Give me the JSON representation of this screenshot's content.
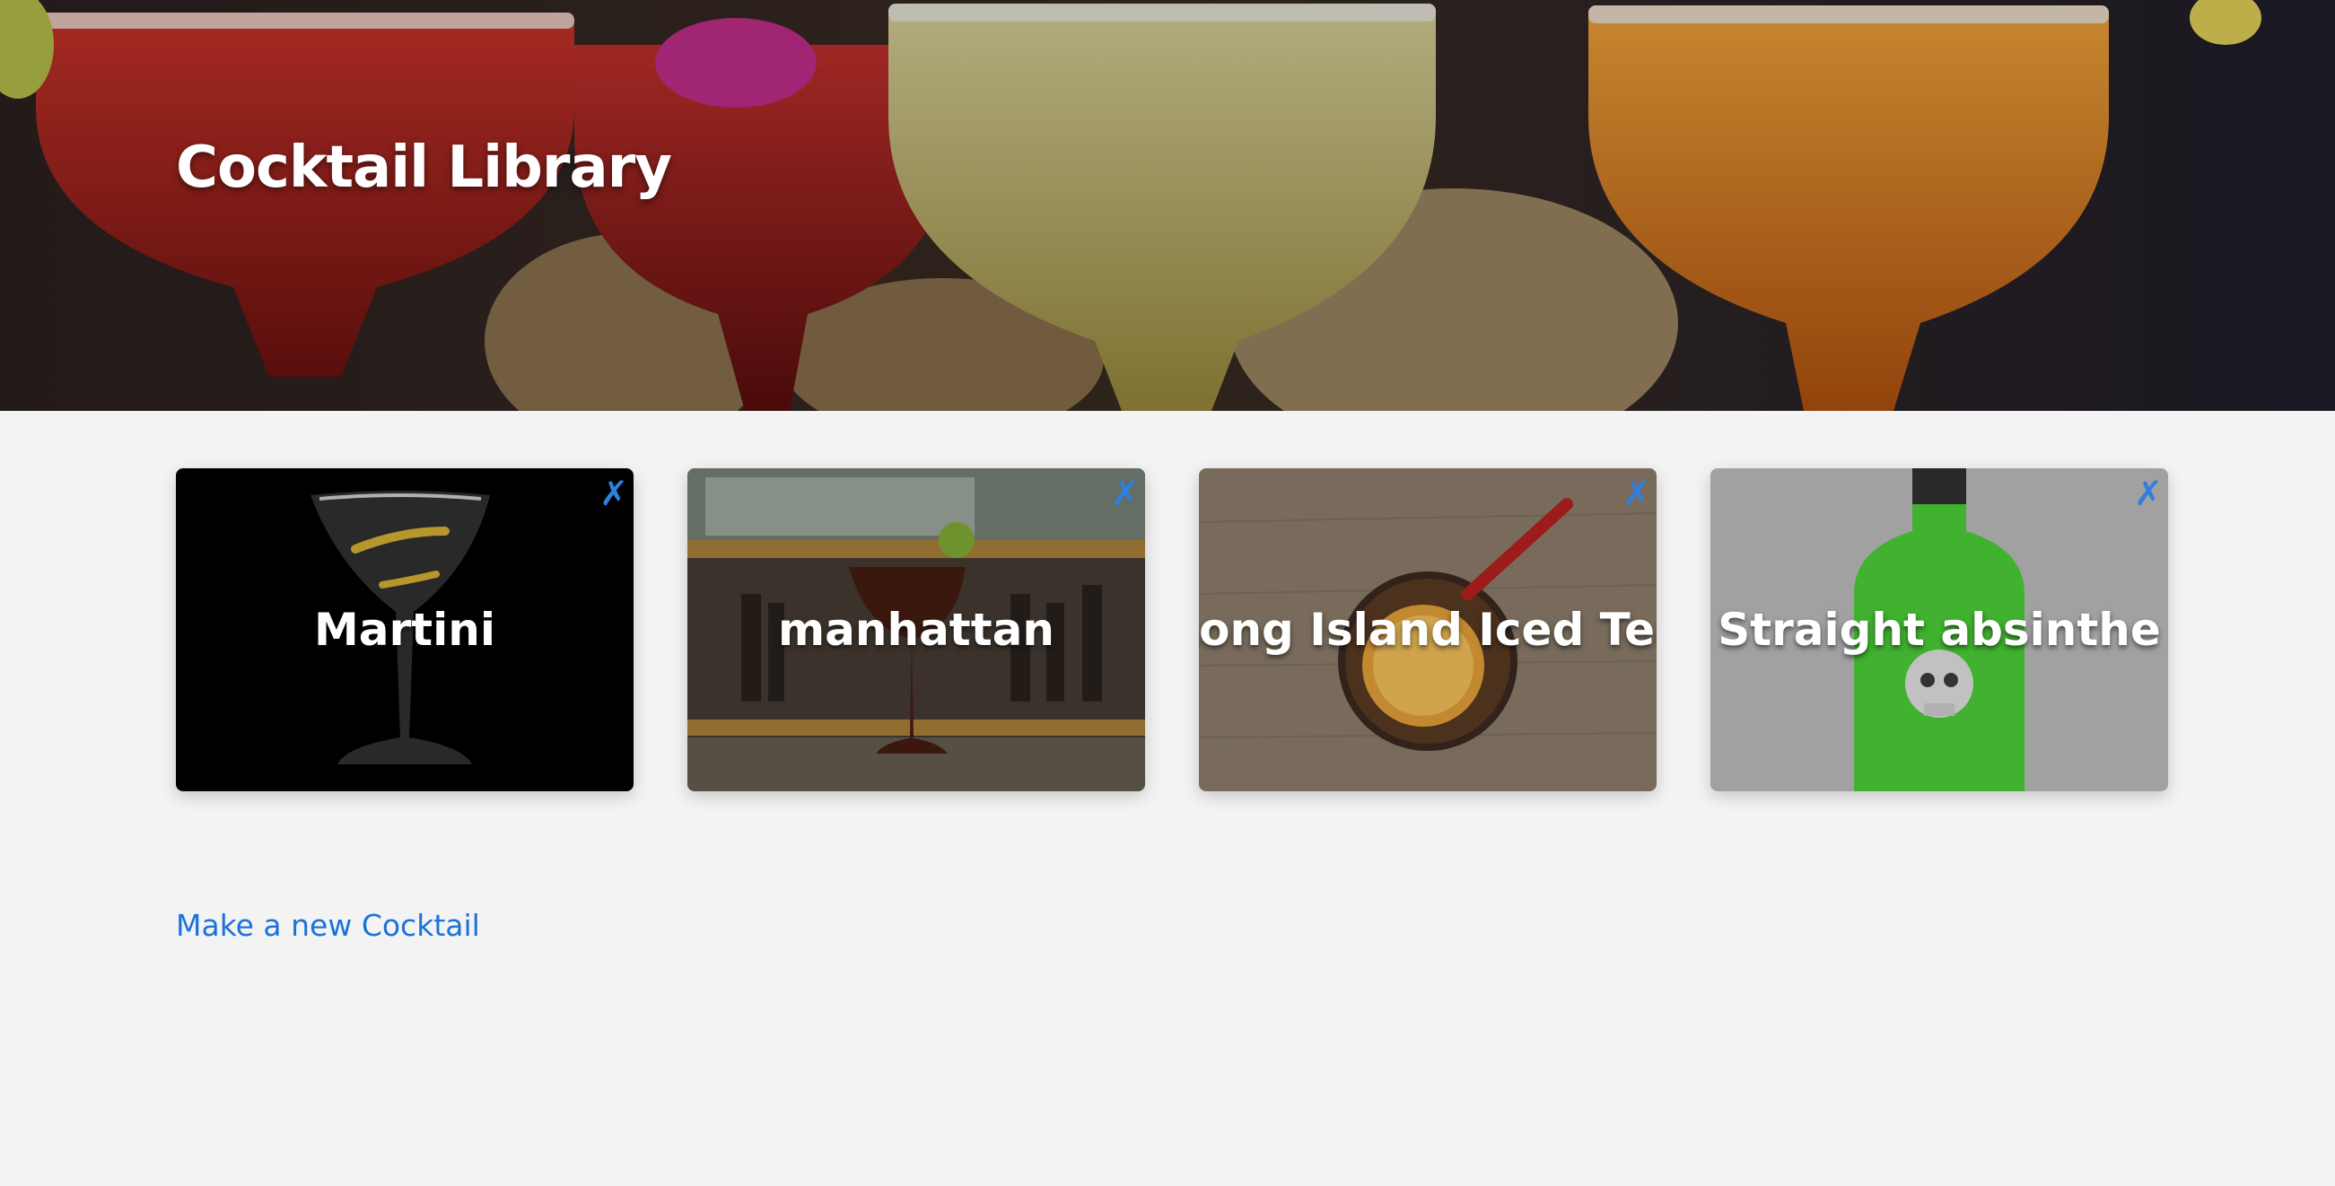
{
  "header": {
    "title": "Cocktail Library"
  },
  "cocktails": [
    {
      "name": "Martini",
      "delete_label": "✗",
      "image": "martini-glass-photo"
    },
    {
      "name": "manhattan",
      "delete_label": "✗",
      "image": "manhattan-bar-photo"
    },
    {
      "name": "Long Island Iced Tea",
      "delete_label": "✗",
      "image": "iced-tea-glass-photo"
    },
    {
      "name": "Straight absinthe",
      "delete_label": "✗",
      "image": "absinthe-bottle-photo"
    }
  ],
  "actions": {
    "new_cocktail": "Make a new Cocktail"
  },
  "colors": {
    "page_background": "#f3f3f3",
    "link": "#1a73d9",
    "delete_icon": "#2f7fe0",
    "card_title": "#ffffff"
  }
}
